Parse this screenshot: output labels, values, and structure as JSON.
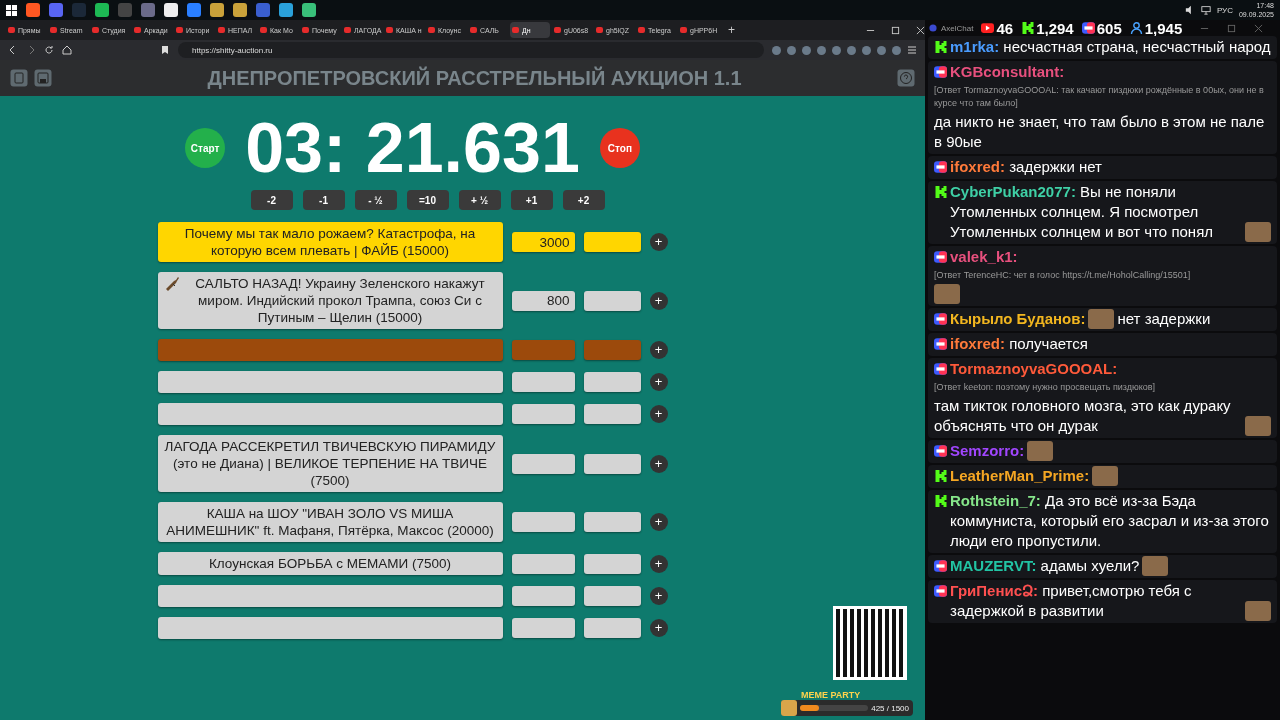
{
  "taskbar": {
    "tray": {
      "language": "РУС",
      "time": "17:48",
      "date": "09.09.2025"
    }
  },
  "browser": {
    "tabs": [
      {
        "title": "Прямы",
        "selected": false
      },
      {
        "title": "Stream",
        "selected": false
      },
      {
        "title": "Студия",
        "selected": false
      },
      {
        "title": "Аркади",
        "selected": false
      },
      {
        "title": "Истори",
        "selected": false
      },
      {
        "title": "НЕПАЛ",
        "selected": false
      },
      {
        "title": "Как Мо",
        "selected": false
      },
      {
        "title": "Почему",
        "selected": false
      },
      {
        "title": "ЛАГОДА",
        "selected": false
      },
      {
        "title": "КАША н",
        "selected": false
      },
      {
        "title": "Клоунс",
        "selected": false
      },
      {
        "title": "САЛЬ",
        "selected": false
      },
      {
        "title": "Дн",
        "selected": true
      },
      {
        "title": "gU06s8",
        "selected": false
      },
      {
        "title": "gh5lQZ",
        "selected": false
      },
      {
        "title": "Telegra",
        "selected": false
      },
      {
        "title": "gHPP6H",
        "selected": false
      }
    ],
    "new_tab": "+",
    "url": "https://shitty-auction.ru"
  },
  "page": {
    "title": "ДНЕПРОПЕТРОВСКИЙ РАССТРЕЛЬНЫЙ АУКЦИОН 1.1",
    "timer": {
      "start": "Старт",
      "time": "03: 21.631",
      "stop": "Стоп"
    },
    "adjust_buttons": [
      "-2",
      "-1",
      "- ½",
      "=10",
      "+ ½",
      "+1",
      "+2"
    ],
    "lots": [
      {
        "name": "Почему мы так мало рожаем? Катастрофа, на которую всем плевать | ФАЙБ (15000)",
        "amount": "3000",
        "color": "#ffd600",
        "icon": false,
        "add": "+"
      },
      {
        "name": "САЛЬТО НАЗАД! Украину Зеленского накажут миром. Индийский прокол Трампа, союз Си с Путиным – Щелин (15000)",
        "amount": "800",
        "color": "#d4d4d4",
        "icon": true,
        "add": "+"
      },
      {
        "color": "#9c4a0c",
        "icon": false,
        "add": "+"
      },
      {
        "color": "#d4d4d4",
        "icon": false,
        "add": "+"
      },
      {
        "color": "#d4d4d4",
        "icon": false,
        "add": "+"
      },
      {
        "name": "ЛАГОДА РАССЕКРЕТИЛ ТВИЧЕВСКУЮ ПИРАМИДУ (это не Диана) | ВЕЛИКОЕ ТЕРПЕНИЕ НА ТВИЧЕ (7500)",
        "color": "#d4d4d4",
        "icon": false,
        "add": "+"
      },
      {
        "name": "КАША на ШОУ \"ИВАН ЗОЛО VS МИША АНИМЕШНИК\" ft. Мафаня, Пятёрка, Максос (20000)",
        "color": "#d4d4d4",
        "icon": false,
        "add": "+"
      },
      {
        "name": "Клоунская БОРЬБА с МЕМАМИ (7500)",
        "color": "#d4d4d4",
        "icon": false,
        "add": "+"
      },
      {
        "color": "#d4d4d4",
        "icon": false,
        "add": "+"
      },
      {
        "color": "#d4d4d4",
        "icon": false,
        "add": "+"
      }
    ],
    "meme_party": {
      "label": "MEME PARTY",
      "count": "425 / 1500",
      "level": 0.28
    }
  },
  "chat": {
    "app": "AxelChat",
    "stats": [
      {
        "kind": "youtube",
        "value": "46"
      },
      {
        "kind": "kick",
        "value": "1,294"
      },
      {
        "kind": "live",
        "value": "605"
      },
      {
        "kind": "viewers",
        "value": "1,945"
      }
    ],
    "messages": [
      {
        "kind": "kick",
        "author": "m1rka:",
        "color": "#4a9cff",
        "text": "несчастная страна, несчастный народ",
        "emote": false
      },
      {
        "kind": "live",
        "author": "KGBconsultant:",
        "color": "#e8507e",
        "reply": "[Ответ TormaznoyvaGOOOAL: так качают пиздюки рождённые в 00ых, они не в курсе что там было]",
        "text": "да никто не знает, что там было в этом не пале в 90ые",
        "emote": false
      },
      {
        "kind": "live",
        "author": "ifoxred:",
        "color": "#ff7a3a",
        "text": "задержки нет",
        "emote": false
      },
      {
        "kind": "kick",
        "author": "CyberPukan2077:",
        "color": "#3fd0a6",
        "text": "Вы не поняли Утомленных солнцем. Я посмотрел Утомленных солнцем и вот что понял",
        "emote": true
      },
      {
        "kind": "live",
        "author": "valek_k1:",
        "color": "#e8507e",
        "reply": "[Ответ TerenceHC: чет в голос https://t.me/HoholCalling/15501]",
        "emote": true
      },
      {
        "kind": "live",
        "author": "Кырыло Буданов:",
        "color": "#f2b61f",
        "text": "нет задержки",
        "emote": true,
        "emote_first": true
      },
      {
        "kind": "live",
        "author": "ifoxred:",
        "color": "#ff7a3a",
        "text": "получается",
        "emote": false
      },
      {
        "kind": "live",
        "author": "TormaznoyvaGOOOAL:",
        "color": "#ff5a3a",
        "reply": "[Ответ keeton: поэтому нужно просвещать пиздюков]",
        "text": "там тикток головного мозга, это как дураку объяснять что он дурак",
        "emote": true
      },
      {
        "kind": "live",
        "author": "Semzorro:",
        "color": "#a146ff",
        "emote": true
      },
      {
        "kind": "kick",
        "author": "LeatherMan_Prime:",
        "color": "#f5a623",
        "emote": true
      },
      {
        "kind": "kick",
        "author": "Rothstein_7:",
        "color": "#86e68a",
        "text": "Да это всё из-за Бэда коммуниста, который его засрал и из-за этого люди его пропустили.",
        "emote": false
      },
      {
        "kind": "live",
        "author": "MAUZERVT:",
        "color": "#22c4a4",
        "text": "адамы хуели?",
        "emote": true
      },
      {
        "kind": "live",
        "author": "ГриПенисՁ:",
        "color": "#ff5050",
        "text": "привет,смотрю тебя с задержкой в развитии",
        "emote": true
      }
    ]
  }
}
